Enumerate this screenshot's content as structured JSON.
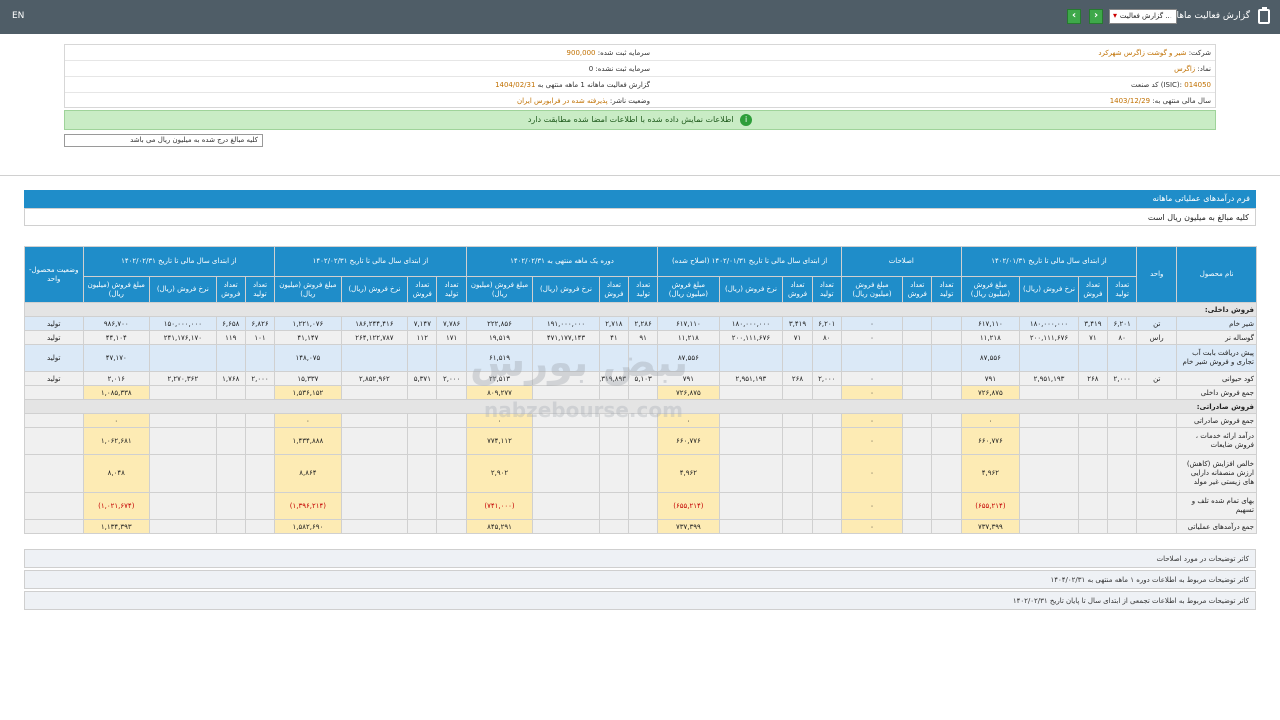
{
  "topbar": {
    "lang": "EN",
    "title": "گزارش فعالیت ماهانه",
    "select_value": "گزارش فعالیت ...",
    "prev": "‹",
    "next": "›"
  },
  "company": {
    "name_label": "شرکت:",
    "name_value": "شیر و گوشت زاگرس شهرکرد",
    "symbol_label": "نماد:",
    "symbol_value": "زاگرس",
    "isic_label": "کد صنعت (ISIC):",
    "isic_value": "014050",
    "year_end_label": "سال مالی منتهی به:",
    "year_end_value": "1403/12/29",
    "capital_label": "سرمایه ثبت شده:",
    "capital_value": "900,000",
    "unreg_capital_label": "سرمایه ثبت نشده:",
    "unreg_capital_value": "0",
    "report_label": "گزارش فعالیت ماهانه 1 ماهه منتهی به",
    "report_value": "1404/02/31",
    "status_label": "وضعیت ناشر:",
    "status_value": "پذیرفته شده در فرابورس ایران"
  },
  "green_message": "اطلاعات نمایش داده شده با اطلاعات امضا شده مطابقت دارد",
  "filter_text": "کلیه مبالغ درج شده به میلیون ریال می باشد",
  "form": {
    "title": "فرم درآمدهای عملیاتی ماهانه",
    "subtitle": "کلیه مبالغ به میلیون ریال است"
  },
  "table": {
    "groups": [
      "نام محصول",
      "واحد",
      "از ابتدای سال مالی تا تاریخ ۱۴۰۲/۰۱/۳۱",
      "اصلاحات",
      "از ابتدای سال مالی تا تاریخ ۱۴۰۲/۰۱/۳۱ (اصلاح شده)",
      "دوره یک ماهه منتهی به ۱۴۰۲/۰۲/۳۱",
      "از ابتدای سال مالی تا تاریخ ۱۴۰۲/۰۲/۳۱",
      "از ابتدای سال مالی تا تاریخ ۱۴۰۲/۰۲/۳۱",
      "وضعیت محصول- واحد"
    ],
    "subcols": {
      "qty_prod": "تعداد تولید",
      "qty_sale": "تعداد فروش",
      "rate": "نرخ فروش (ریال)",
      "amount": "مبلغ فروش (میلیون ریال)"
    },
    "section_domestic": "فروش داخلی:",
    "section_export": "فروش صادراتی:",
    "rows": [
      {
        "name": "شیر خام",
        "unit": "تن",
        "c": [
          "۶,۲۰۱",
          "۳,۴۱۹",
          "۱۸۰,۰۰۰,۰۰۰",
          "۶۱۷,۱۱۰",
          "",
          "",
          "۰",
          "۶,۲۰۱",
          "۳,۴۱۹",
          "۱۸۰,۰۰۰,۰۰۰",
          "۶۱۷,۱۱۰",
          "۲,۲۸۶",
          "۲,۷۱۸",
          "۱۹۱,۰۰۰,۰۰۰",
          "۲۲۲,۸۵۶",
          "۷,۷۸۶",
          "۷,۱۴۷",
          "۱۸۶,۲۴۴,۴۱۶",
          "۱,۲۲۱,۰۷۶",
          "۶,۸۲۶",
          "۶,۶۵۸",
          "۱۵۰,۰۰۰,۰۰۰",
          "۹۸۶,۷۰۰"
        ],
        "status": "تولید",
        "cls": "blue"
      },
      {
        "name": "گوساله نر",
        "unit": "راس",
        "c": [
          "۸۰",
          "۷۱",
          "۲۰۰,۱۱۱,۶۷۶",
          "۱۱,۲۱۸",
          "",
          "",
          "۰",
          "۸۰",
          "۷۱",
          "۲۰۰,۱۱۱,۶۷۶",
          "۱۱,۲۱۸",
          "۹۱",
          "۴۱",
          "۴۷۱,۱۷۷,۱۴۳",
          "۱۹,۵۱۹",
          "۱۷۱",
          "۱۱۲",
          "۲۶۴,۱۲۲,۷۸۷",
          "۴۱,۱۴۷",
          "۱۰۱",
          "۱۱۹",
          "۲۴۱,۱۷۶,۱۷۰",
          "۴۴,۱۰۴"
        ],
        "status": "تولید",
        "cls": ""
      },
      {
        "name": "پیش دریافت بابت آب تجاری و فروش شیر خام",
        "unit": "",
        "c": [
          "",
          "",
          "",
          "۸۷,۵۵۶",
          "",
          "",
          "",
          "",
          "",
          "",
          "۸۷,۵۵۶",
          "",
          "",
          "",
          "۶۱,۵۱۹",
          "",
          "",
          "",
          "۱۴۸,۰۷۵",
          "",
          "",
          "",
          "۴۷,۱۷۰"
        ],
        "status": "تولید",
        "cls": "blue"
      },
      {
        "name": "کود حیوانی",
        "unit": "تن",
        "c": [
          "۲,۰۰۰",
          "۲۶۸",
          "۲,۹۵۱,۱۹۳",
          "۷۹۱",
          "",
          "",
          "۰",
          "۲,۰۰۰",
          "۲۶۸",
          "۲,۹۵۱,۱۹۳",
          "۷۹۱",
          "۵,۱۰۳",
          "۵,۳۱۹,۸۹۳",
          "",
          "۲۲,۵۱۳",
          "۲,۰۰۰",
          "۵,۳۷۱",
          "۲,۸۵۲,۹۶۲",
          "۱۵,۳۳۷",
          "۲,۰۰۰",
          "۱,۷۶۸",
          "۲,۲۷۰,۳۶۲",
          "۲,۰۱۶"
        ],
        "status": "تولید",
        "cls": ""
      }
    ],
    "totals": [
      {
        "name": "جمع فروش داخلی",
        "a1": "۷۲۶,۸۷۵",
        "a2": "۰",
        "a3": "۷۲۶,۸۷۵",
        "a4": "۸۰۹,۲۷۷",
        "a5": "۱,۵۳۶,۱۵۲",
        "a6": "۱,۰۸۵,۳۳۸"
      },
      {
        "name": "جمع فروش صادراتی",
        "a1": "۰",
        "a2": "۰",
        "a3": "۰",
        "a4": "۰",
        "a5": "۰",
        "a6": "۰"
      },
      {
        "name": "درآمد ارائه خدمات ، فروش ضایعات",
        "a1": "۶۶۰,۷۷۶",
        "a2": "۰",
        "a3": "۶۶۰,۷۷۶",
        "a4": "۷۷۴,۱۱۲",
        "a5": "۱,۴۳۴,۸۸۸",
        "a6": "۱,۰۶۲,۶۸۱"
      },
      {
        "name": "خالص افزایش (کاهش) ارزش منصفانه دارایی های زیستی غیر مولد",
        "a1": "۴,۹۶۲",
        "a2": "۰",
        "a3": "۴,۹۶۲",
        "a4": "۲,۹۰۲",
        "a5": "۸,۸۶۴",
        "a6": "۸,۰۴۸"
      },
      {
        "name": "بهای تمام شده تلف و تسهیم",
        "a1": "(۶۵۵,۲۱۴)",
        "a2": "۰",
        "a3": "(۶۵۵,۲۱۴)",
        "a4": "(۷۴۱,۰۰۰)",
        "a5": "(۱,۳۹۶,۲۱۴)",
        "a6": "(۱,۰۲۱,۶۷۴)",
        "neg": true
      },
      {
        "name": "جمع درآمدهای عملیاتی",
        "a1": "۷۳۷,۳۹۹",
        "a2": "۰",
        "a3": "۷۳۷,۳۹۹",
        "a4": "۸۴۵,۲۹۱",
        "a5": "۱,۵۸۲,۶۹۰",
        "a6": "۱,۱۳۴,۳۹۳"
      }
    ]
  },
  "notes": [
    "کاتر توضیحات در مورد اصلاحات",
    "کاتر توضیحات مربوط به اطلاعات دوره ۱ ماهه منتهی به ۱۴۰۴/۰۲/۳۱",
    "کاتر توضیحات مربوط به اطلاعات تجمعی از ابتدای سال تا پایان تاریخ ۱۴۰۲/۰۲/۳۱"
  ],
  "watermark": {
    "brand": "نبض بورس",
    "site": "nabzebourse.com"
  }
}
